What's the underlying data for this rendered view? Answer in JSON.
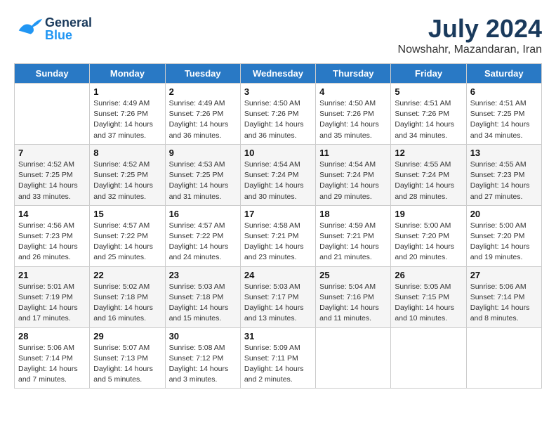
{
  "header": {
    "logo_general": "General",
    "logo_blue": "Blue",
    "title": "July 2024",
    "subtitle": "Nowshahr, Mazandaran, Iran"
  },
  "calendar": {
    "days_of_week": [
      "Sunday",
      "Monday",
      "Tuesday",
      "Wednesday",
      "Thursday",
      "Friday",
      "Saturday"
    ],
    "weeks": [
      [
        {
          "date": "",
          "sunrise": "",
          "sunset": "",
          "daylight": ""
        },
        {
          "date": "1",
          "sunrise": "Sunrise: 4:49 AM",
          "sunset": "Sunset: 7:26 PM",
          "daylight": "Daylight: 14 hours and 37 minutes."
        },
        {
          "date": "2",
          "sunrise": "Sunrise: 4:49 AM",
          "sunset": "Sunset: 7:26 PM",
          "daylight": "Daylight: 14 hours and 36 minutes."
        },
        {
          "date": "3",
          "sunrise": "Sunrise: 4:50 AM",
          "sunset": "Sunset: 7:26 PM",
          "daylight": "Daylight: 14 hours and 36 minutes."
        },
        {
          "date": "4",
          "sunrise": "Sunrise: 4:50 AM",
          "sunset": "Sunset: 7:26 PM",
          "daylight": "Daylight: 14 hours and 35 minutes."
        },
        {
          "date": "5",
          "sunrise": "Sunrise: 4:51 AM",
          "sunset": "Sunset: 7:26 PM",
          "daylight": "Daylight: 14 hours and 34 minutes."
        },
        {
          "date": "6",
          "sunrise": "Sunrise: 4:51 AM",
          "sunset": "Sunset: 7:25 PM",
          "daylight": "Daylight: 14 hours and 34 minutes."
        }
      ],
      [
        {
          "date": "7",
          "sunrise": "Sunrise: 4:52 AM",
          "sunset": "Sunset: 7:25 PM",
          "daylight": "Daylight: 14 hours and 33 minutes."
        },
        {
          "date": "8",
          "sunrise": "Sunrise: 4:52 AM",
          "sunset": "Sunset: 7:25 PM",
          "daylight": "Daylight: 14 hours and 32 minutes."
        },
        {
          "date": "9",
          "sunrise": "Sunrise: 4:53 AM",
          "sunset": "Sunset: 7:25 PM",
          "daylight": "Daylight: 14 hours and 31 minutes."
        },
        {
          "date": "10",
          "sunrise": "Sunrise: 4:54 AM",
          "sunset": "Sunset: 7:24 PM",
          "daylight": "Daylight: 14 hours and 30 minutes."
        },
        {
          "date": "11",
          "sunrise": "Sunrise: 4:54 AM",
          "sunset": "Sunset: 7:24 PM",
          "daylight": "Daylight: 14 hours and 29 minutes."
        },
        {
          "date": "12",
          "sunrise": "Sunrise: 4:55 AM",
          "sunset": "Sunset: 7:24 PM",
          "daylight": "Daylight: 14 hours and 28 minutes."
        },
        {
          "date": "13",
          "sunrise": "Sunrise: 4:55 AM",
          "sunset": "Sunset: 7:23 PM",
          "daylight": "Daylight: 14 hours and 27 minutes."
        }
      ],
      [
        {
          "date": "14",
          "sunrise": "Sunrise: 4:56 AM",
          "sunset": "Sunset: 7:23 PM",
          "daylight": "Daylight: 14 hours and 26 minutes."
        },
        {
          "date": "15",
          "sunrise": "Sunrise: 4:57 AM",
          "sunset": "Sunset: 7:22 PM",
          "daylight": "Daylight: 14 hours and 25 minutes."
        },
        {
          "date": "16",
          "sunrise": "Sunrise: 4:57 AM",
          "sunset": "Sunset: 7:22 PM",
          "daylight": "Daylight: 14 hours and 24 minutes."
        },
        {
          "date": "17",
          "sunrise": "Sunrise: 4:58 AM",
          "sunset": "Sunset: 7:21 PM",
          "daylight": "Daylight: 14 hours and 23 minutes."
        },
        {
          "date": "18",
          "sunrise": "Sunrise: 4:59 AM",
          "sunset": "Sunset: 7:21 PM",
          "daylight": "Daylight: 14 hours and 21 minutes."
        },
        {
          "date": "19",
          "sunrise": "Sunrise: 5:00 AM",
          "sunset": "Sunset: 7:20 PM",
          "daylight": "Daylight: 14 hours and 20 minutes."
        },
        {
          "date": "20",
          "sunrise": "Sunrise: 5:00 AM",
          "sunset": "Sunset: 7:20 PM",
          "daylight": "Daylight: 14 hours and 19 minutes."
        }
      ],
      [
        {
          "date": "21",
          "sunrise": "Sunrise: 5:01 AM",
          "sunset": "Sunset: 7:19 PM",
          "daylight": "Daylight: 14 hours and 17 minutes."
        },
        {
          "date": "22",
          "sunrise": "Sunrise: 5:02 AM",
          "sunset": "Sunset: 7:18 PM",
          "daylight": "Daylight: 14 hours and 16 minutes."
        },
        {
          "date": "23",
          "sunrise": "Sunrise: 5:03 AM",
          "sunset": "Sunset: 7:18 PM",
          "daylight": "Daylight: 14 hours and 15 minutes."
        },
        {
          "date": "24",
          "sunrise": "Sunrise: 5:03 AM",
          "sunset": "Sunset: 7:17 PM",
          "daylight": "Daylight: 14 hours and 13 minutes."
        },
        {
          "date": "25",
          "sunrise": "Sunrise: 5:04 AM",
          "sunset": "Sunset: 7:16 PM",
          "daylight": "Daylight: 14 hours and 11 minutes."
        },
        {
          "date": "26",
          "sunrise": "Sunrise: 5:05 AM",
          "sunset": "Sunset: 7:15 PM",
          "daylight": "Daylight: 14 hours and 10 minutes."
        },
        {
          "date": "27",
          "sunrise": "Sunrise: 5:06 AM",
          "sunset": "Sunset: 7:14 PM",
          "daylight": "Daylight: 14 hours and 8 minutes."
        }
      ],
      [
        {
          "date": "28",
          "sunrise": "Sunrise: 5:06 AM",
          "sunset": "Sunset: 7:14 PM",
          "daylight": "Daylight: 14 hours and 7 minutes."
        },
        {
          "date": "29",
          "sunrise": "Sunrise: 5:07 AM",
          "sunset": "Sunset: 7:13 PM",
          "daylight": "Daylight: 14 hours and 5 minutes."
        },
        {
          "date": "30",
          "sunrise": "Sunrise: 5:08 AM",
          "sunset": "Sunset: 7:12 PM",
          "daylight": "Daylight: 14 hours and 3 minutes."
        },
        {
          "date": "31",
          "sunrise": "Sunrise: 5:09 AM",
          "sunset": "Sunset: 7:11 PM",
          "daylight": "Daylight: 14 hours and 2 minutes."
        },
        {
          "date": "",
          "sunrise": "",
          "sunset": "",
          "daylight": ""
        },
        {
          "date": "",
          "sunrise": "",
          "sunset": "",
          "daylight": ""
        },
        {
          "date": "",
          "sunrise": "",
          "sunset": "",
          "daylight": ""
        }
      ]
    ]
  }
}
